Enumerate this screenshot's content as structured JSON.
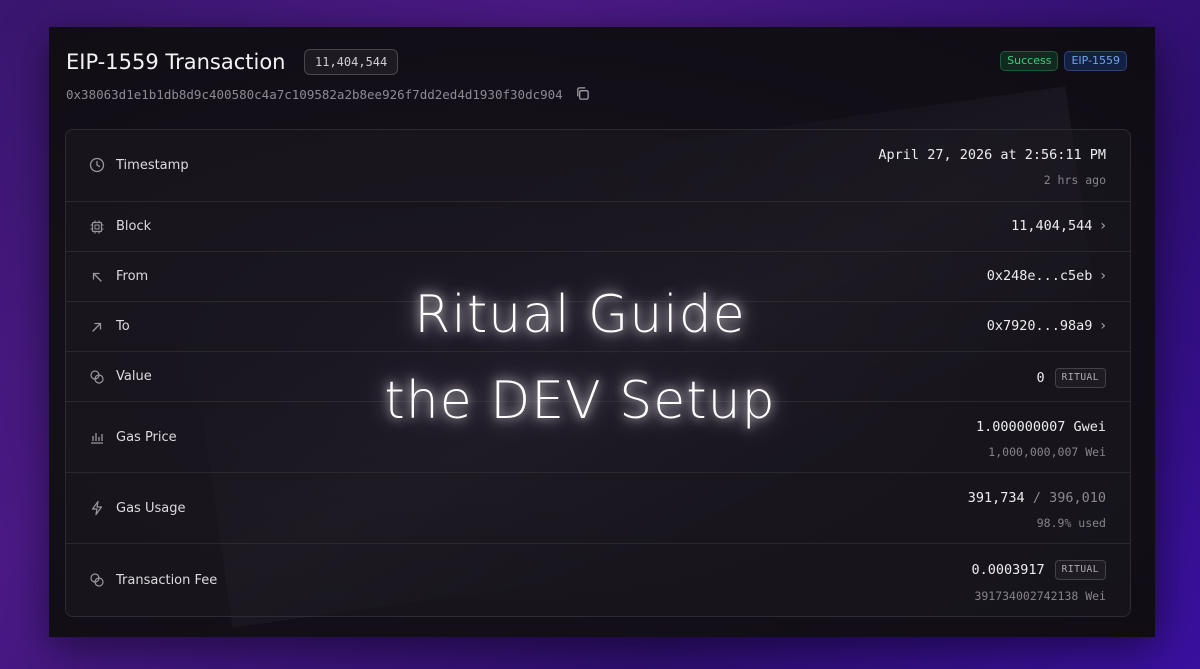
{
  "header": {
    "title": "EIP-1559 Transaction",
    "block_pill": "11,404,544",
    "hash": "0x38063d1e1b1db8d9c400580c4a7c109582a2b8ee926f7dd2ed4d1930f30dc904",
    "badges": {
      "status": "Success",
      "type": "EIP-1559"
    },
    "colors": {
      "success": "#3ccf83",
      "type": "#6ea3ef"
    }
  },
  "rows": {
    "timestamp": {
      "label": "Timestamp",
      "value": "April 27, 2026 at 2:56:11 PM",
      "sub": "2 hrs ago",
      "icon": "clock-icon"
    },
    "block": {
      "label": "Block",
      "value": "11,404,544",
      "icon": "cpu-chip-icon"
    },
    "from": {
      "label": "From",
      "value": "0x248e...c5eb",
      "icon": "arrow-up-left-icon"
    },
    "to": {
      "label": "To",
      "value": "0x7920...98a9",
      "icon": "arrow-up-right-icon"
    },
    "value": {
      "label": "Value",
      "value": "0",
      "unit": "RITUAL",
      "icon": "coins-icon"
    },
    "gas_price": {
      "label": "Gas Price",
      "value": "1.000000007 Gwei",
      "sub": "1,000,000,007 Wei",
      "icon": "bar-chart-icon"
    },
    "gas_usage": {
      "label": "Gas Usage",
      "used": "391,734",
      "separator": "/",
      "limit": "396,010",
      "sub": "98.9% used",
      "icon": "lightning-icon"
    },
    "fee": {
      "label": "Transaction Fee",
      "value": "0.0003917",
      "unit": "RITUAL",
      "sub": "391734002742138 Wei",
      "icon": "coins-icon"
    }
  },
  "overlay": {
    "line1": "Ritual Guide",
    "line2": "the DEV Setup"
  }
}
